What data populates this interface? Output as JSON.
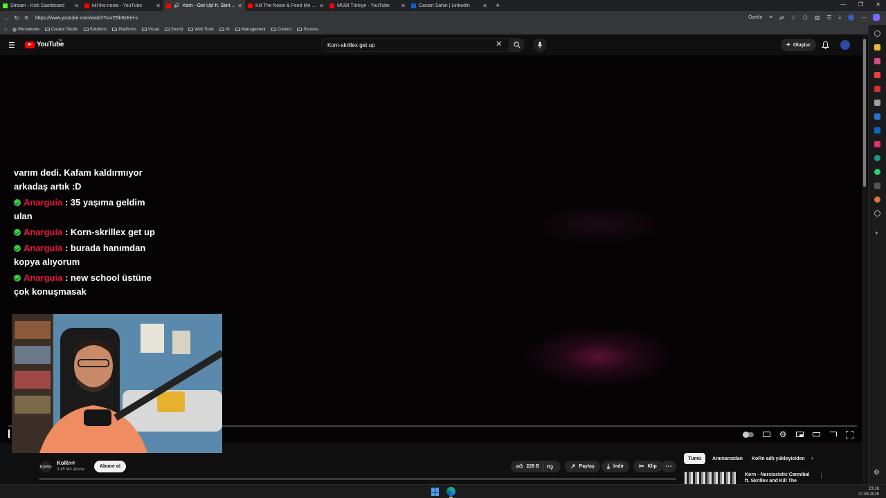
{
  "browser": {
    "tabs": [
      {
        "title": "Stream - Kick Dashboard",
        "favicon_color": "#53fc18",
        "active": false
      },
      {
        "title": "kill the noise - YouTube",
        "favicon_color": "#ff0000",
        "active": false
      },
      {
        "title": "Korn - Get Up! ft. Skrillex [O",
        "favicon_color": "#ff0000",
        "active": true
      },
      {
        "title": "Kill The Noise & Feed Me - I Do C",
        "favicon_color": "#ff0000",
        "active": false
      },
      {
        "title": "MUBI Türkiye - YouTube",
        "favicon_color": "#ff0000",
        "active": false
      },
      {
        "title": "Cansin Sahin | LinkedIn",
        "favicon_color": "#0a66c2",
        "active": false
      }
    ],
    "url": "https://www.youtube.com/watch?v=rZSh9zKel-s",
    "summarize_label": "Özetle",
    "bookmarks": [
      "Persodome",
      "Creator Studio",
      "Solutions",
      "Platforms",
      "Visual",
      "Sound",
      "Web Tools",
      "AI",
      "Management",
      "Contact",
      "Sources"
    ]
  },
  "youtube": {
    "logo_text": "YouTube",
    "region": "TR",
    "search_query": "Korn-skrillex get up",
    "create_label": "Oluştur"
  },
  "chat": {
    "partial_text": "varım dedi. Kafam kaldırmıyor arkadaş artık :D",
    "messages": [
      {
        "user": "Anarguia",
        "text": ": 35 yaşıma geldim ulan"
      },
      {
        "user": "Anarguia",
        "text": ": Korn-skrillex get up"
      },
      {
        "user": "Anarguia",
        "text": ": burada hanımdan kopya alıyorum"
      },
      {
        "user": "Anarguia",
        "text": ": new school üstüne çok konuşmasak"
      }
    ]
  },
  "player": {
    "progress_fraction": 0.0
  },
  "channel": {
    "logo_text": "KoRn",
    "name": "KoRn",
    "subscribers": "3,45 Mn abone",
    "subscribe_label": "Abone ol"
  },
  "actions": {
    "likes": "226 B",
    "share_label": "Paylaş",
    "download_label": "İndir",
    "clip_label": "Klip"
  },
  "sidebar": {
    "chips": [
      "Tümü",
      "Aramanızdan",
      "KoRn adlı yükleyiciden"
    ],
    "recommendation_title": "Korn - Narcissistic Cannibal ft. Skrillex and Kill The Noise"
  },
  "taskbar": {
    "time": "23:16",
    "date": "27.08.2025"
  },
  "colors": {
    "accent_red": "#ff0000",
    "chat_username": "#e8173c",
    "verified_green": "#3ccb3c"
  }
}
